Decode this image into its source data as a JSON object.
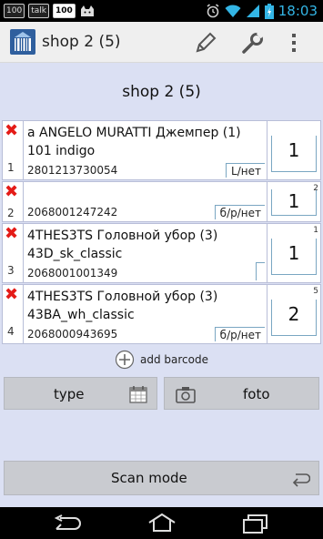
{
  "status_bar": {
    "left_badges": [
      "100",
      "talk",
      "100"
    ],
    "time": "18:03",
    "icons": [
      "alarm-icon",
      "wifi-icon",
      "signal-icon",
      "battery-icon"
    ]
  },
  "action_bar": {
    "title": "shop 2 (5)",
    "icons": [
      "app-barcode-icon",
      "edit-pencil-icon",
      "settings-wrench-icon",
      "overflow-menu-icon"
    ]
  },
  "page": {
    "title": "shop 2 (5)"
  },
  "items": [
    {
      "num": "1",
      "name": "a ANGELO MURATTI Джемпер (1) 101 indigo",
      "barcode": "2801213730054",
      "size": "L/нет",
      "qty": "1",
      "qty_sup": ""
    },
    {
      "num": "2",
      "name": "",
      "barcode": "2068001247242",
      "size": "б/р/нет",
      "qty": "1",
      "qty_sup": "2"
    },
    {
      "num": "3",
      "name": "4THES3TS Головной убор (3) 43D_sk_classic",
      "barcode": "2068001001349",
      "size": "",
      "qty": "1",
      "qty_sup": "1"
    },
    {
      "num": "4",
      "name": "4THES3TS Головной убор (3) 43BA_wh_classic",
      "barcode": "2068000943695",
      "size": "б/р/нет",
      "qty": "2",
      "qty_sup": "5"
    }
  ],
  "add_barcode": {
    "label": "add barcode"
  },
  "buttons": {
    "type": "type",
    "foto": "foto",
    "scan_mode": "Scan mode"
  },
  "colors": {
    "accent": "#33b5e5",
    "delete": "#e41b17",
    "content_bg": "#dbe0f3",
    "button_bg": "#c9cbd0"
  }
}
